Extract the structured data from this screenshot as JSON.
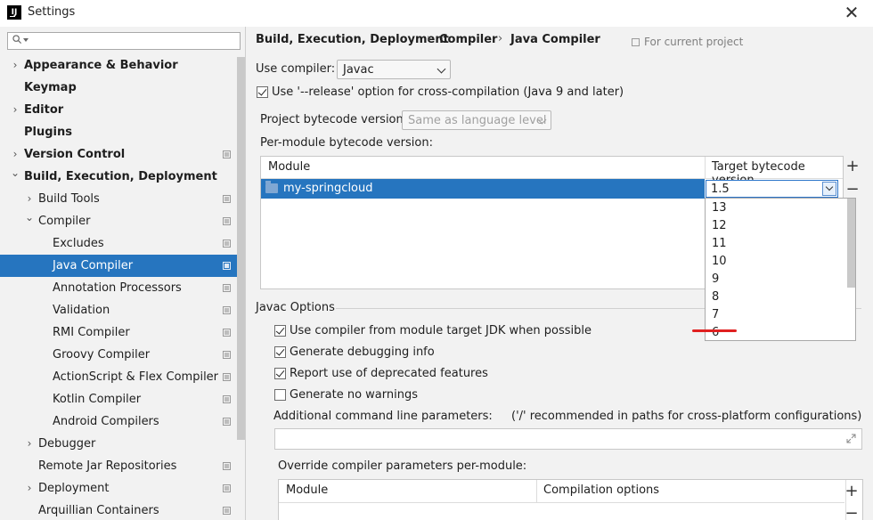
{
  "window": {
    "title": "Settings",
    "app_icon_text": "IJ"
  },
  "sidebar": {
    "search": {
      "placeholder": "",
      "value": ""
    },
    "items": [
      {
        "label": "Appearance & Behavior",
        "bold": true,
        "expander": "collapsed",
        "indent": 0,
        "project": false
      },
      {
        "label": "Keymap",
        "bold": true,
        "expander": "none",
        "indent": 0,
        "project": false
      },
      {
        "label": "Editor",
        "bold": true,
        "expander": "collapsed",
        "indent": 0,
        "project": false
      },
      {
        "label": "Plugins",
        "bold": true,
        "expander": "none",
        "indent": 0,
        "project": false
      },
      {
        "label": "Version Control",
        "bold": true,
        "expander": "collapsed",
        "indent": 0,
        "project": true
      },
      {
        "label": "Build, Execution, Deployment",
        "bold": true,
        "expander": "expanded",
        "indent": 0,
        "project": false
      },
      {
        "label": "Build Tools",
        "bold": false,
        "expander": "collapsed",
        "indent": 1,
        "project": true
      },
      {
        "label": "Compiler",
        "bold": false,
        "expander": "expanded",
        "indent": 1,
        "project": true
      },
      {
        "label": "Excludes",
        "bold": false,
        "expander": "none",
        "indent": 2,
        "project": true
      },
      {
        "label": "Java Compiler",
        "bold": false,
        "expander": "none",
        "indent": 2,
        "project": true,
        "selected": true
      },
      {
        "label": "Annotation Processors",
        "bold": false,
        "expander": "none",
        "indent": 2,
        "project": true
      },
      {
        "label": "Validation",
        "bold": false,
        "expander": "none",
        "indent": 2,
        "project": true
      },
      {
        "label": "RMI Compiler",
        "bold": false,
        "expander": "none",
        "indent": 2,
        "project": true
      },
      {
        "label": "Groovy Compiler",
        "bold": false,
        "expander": "none",
        "indent": 2,
        "project": true
      },
      {
        "label": "ActionScript & Flex Compiler",
        "bold": false,
        "expander": "none",
        "indent": 2,
        "project": true
      },
      {
        "label": "Kotlin Compiler",
        "bold": false,
        "expander": "none",
        "indent": 2,
        "project": true
      },
      {
        "label": "Android Compilers",
        "bold": false,
        "expander": "none",
        "indent": 2,
        "project": true
      },
      {
        "label": "Debugger",
        "bold": false,
        "expander": "collapsed",
        "indent": 1,
        "project": false
      },
      {
        "label": "Remote Jar Repositories",
        "bold": false,
        "expander": "none",
        "indent": 1,
        "project": true
      },
      {
        "label": "Deployment",
        "bold": false,
        "expander": "collapsed",
        "indent": 1,
        "project": true
      },
      {
        "label": "Arquillian Containers",
        "bold": false,
        "expander": "none",
        "indent": 1,
        "project": true
      }
    ]
  },
  "breadcrumb": [
    "Build, Execution, Deployment",
    "Compiler",
    "Java Compiler"
  ],
  "breadcrumb_separator": "›",
  "for_project": "For current project",
  "use_compiler": {
    "label": "Use compiler:",
    "value": "Javac"
  },
  "release_option": {
    "label": "Use '--release' option for cross-compilation (Java 9 and later)",
    "checked": true
  },
  "project_bytecode": {
    "label": "Project bytecode version:",
    "value": "Same as language level"
  },
  "per_module": {
    "label": "Per-module bytecode version:",
    "columns": [
      "Module",
      "Target bytecode version"
    ],
    "rows": [
      {
        "module": "my-springcloud",
        "version": "1.5"
      }
    ],
    "dropdown_options": [
      "13",
      "12",
      "11",
      "10",
      "9",
      "8",
      "7",
      "6"
    ]
  },
  "javac_options": {
    "title": "Javac Options",
    "checkboxes": [
      {
        "label": "Use compiler from module target JDK when possible",
        "checked": true
      },
      {
        "label": "Generate debugging info",
        "checked": true
      },
      {
        "label": "Report use of deprecated features",
        "checked": true
      },
      {
        "label": "Generate no warnings",
        "checked": false
      }
    ],
    "additional_label": "Additional command line parameters:",
    "additional_hint": "('/' recommended in paths for cross-platform configurations)",
    "additional_value": ""
  },
  "override": {
    "label": "Override compiler parameters per-module:",
    "columns": [
      "Module",
      "Compilation options"
    ]
  },
  "colors": {
    "selection": "#2675bf",
    "highlight_mark": "#e02020"
  }
}
